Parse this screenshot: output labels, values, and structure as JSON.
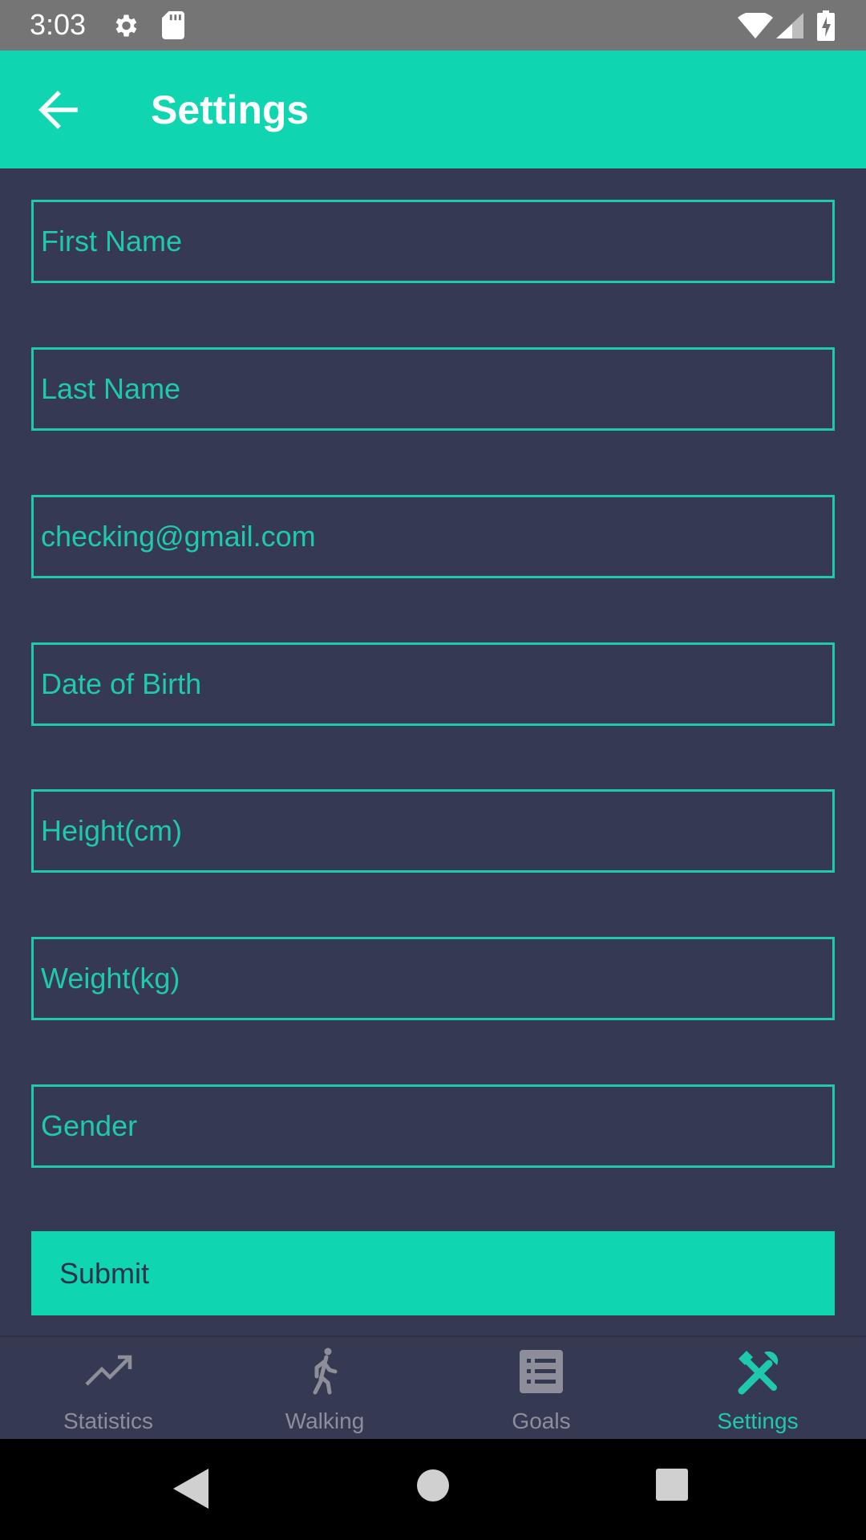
{
  "status_bar": {
    "time": "3:03",
    "icons": [
      "gear-icon",
      "sd-card-icon",
      "wifi-icon",
      "signal-icon",
      "battery-charging-icon"
    ]
  },
  "app_bar": {
    "title": "Settings",
    "back_icon": "arrow-left-icon"
  },
  "form": {
    "fields": [
      {
        "name": "first-name",
        "value": "",
        "placeholder": "First Name"
      },
      {
        "name": "last-name",
        "value": "",
        "placeholder": "Last Name"
      },
      {
        "name": "email",
        "value": "checking@gmail.com",
        "placeholder": ""
      },
      {
        "name": "date-of-birth",
        "value": "",
        "placeholder": "Date of Birth"
      },
      {
        "name": "height",
        "value": "",
        "placeholder": "Height(cm)"
      },
      {
        "name": "weight",
        "value": "",
        "placeholder": "Weight(kg)"
      },
      {
        "name": "gender",
        "value": "",
        "placeholder": "Gender"
      }
    ],
    "submit_label": "Submit"
  },
  "bottom_nav": {
    "items": [
      {
        "label": "Statistics",
        "icon": "trending-up-icon",
        "active": false
      },
      {
        "label": "Walking",
        "icon": "walking-person-icon",
        "active": false
      },
      {
        "label": "Goals",
        "icon": "list-icon",
        "active": false
      },
      {
        "label": "Settings",
        "icon": "tools-icon",
        "active": true
      }
    ]
  },
  "colors": {
    "accent": "#0fd6b1",
    "field_text": "#1ec9ad",
    "background": "#363952",
    "inactive_nav": "#8d8e9a",
    "status_bar": "#757575"
  }
}
